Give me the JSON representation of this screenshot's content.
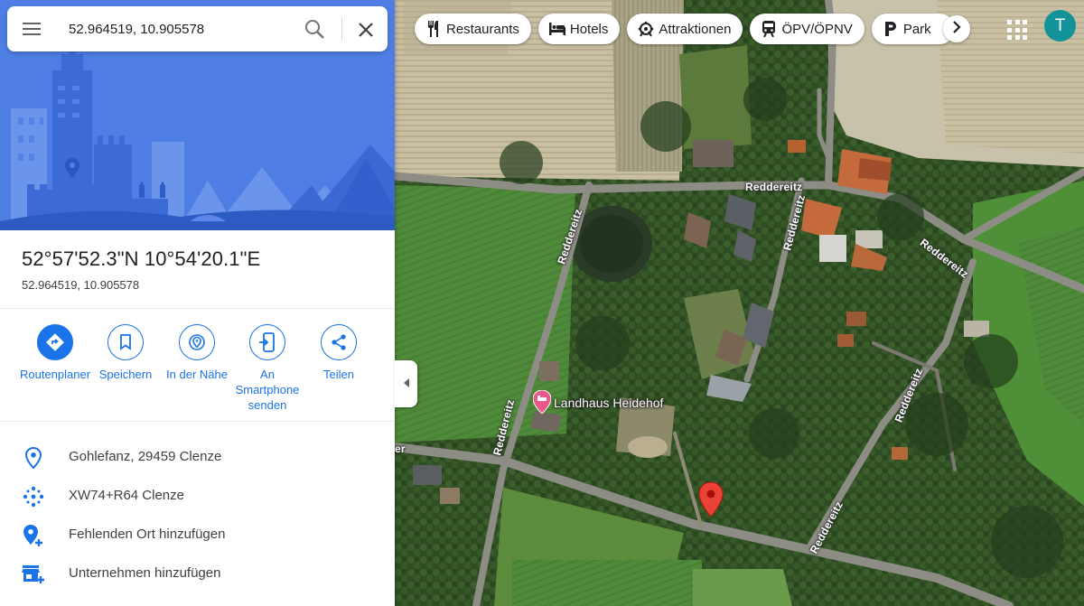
{
  "search": {
    "value": "52.964519, 10.905578",
    "menu_icon": "hamburger-menu-icon",
    "search_icon": "magnifier-icon",
    "close_icon": "close-x-icon"
  },
  "place": {
    "title": "52°57'52.3\"N 10°54'20.1\"E",
    "subtitle": "52.964519, 10.905578"
  },
  "actions": [
    {
      "label": "Routenplaner",
      "icon": "directions-icon"
    },
    {
      "label": "Speichern",
      "icon": "bookmark-icon"
    },
    {
      "label": "In der Nähe",
      "icon": "nearby-icon"
    },
    {
      "label": "An Smartphone senden",
      "icon": "send-to-phone-icon"
    },
    {
      "label": "Teilen",
      "icon": "share-icon"
    }
  ],
  "info_rows": [
    {
      "text": "Gohlefanz, 29459 Clenze",
      "icon": "location-pin-icon"
    },
    {
      "text": "XW74+R64 Clenze",
      "icon": "plus-code-icon"
    },
    {
      "text": "Fehlenden Ort hinzufügen",
      "icon": "add-place-icon"
    },
    {
      "text": "Unternehmen hinzufügen",
      "icon": "add-business-icon"
    }
  ],
  "chips": [
    {
      "label": "Restaurants",
      "icon": "fork-knife-icon"
    },
    {
      "label": "Hotels",
      "icon": "bed-icon"
    },
    {
      "label": "Attraktionen",
      "icon": "attraction-icon"
    },
    {
      "label": "ÖPV/ÖPNV",
      "icon": "train-icon"
    },
    {
      "label": "Park",
      "icon": "parking-icon"
    }
  ],
  "user": {
    "initial": "T"
  },
  "map": {
    "road_labels": [
      "Reddereitz",
      "Reddereitz",
      "Reddereitz",
      "Reddereitz",
      "Reddereitz",
      "Reddereitz",
      "er"
    ],
    "poi": "Landhaus Heidehof",
    "pin_color": "#ea4335",
    "poi_color": "#e8588a"
  },
  "colors": {
    "accent": "#1a73e8",
    "hero_bg": "#4e7ee3",
    "avatar": "#12939a"
  }
}
